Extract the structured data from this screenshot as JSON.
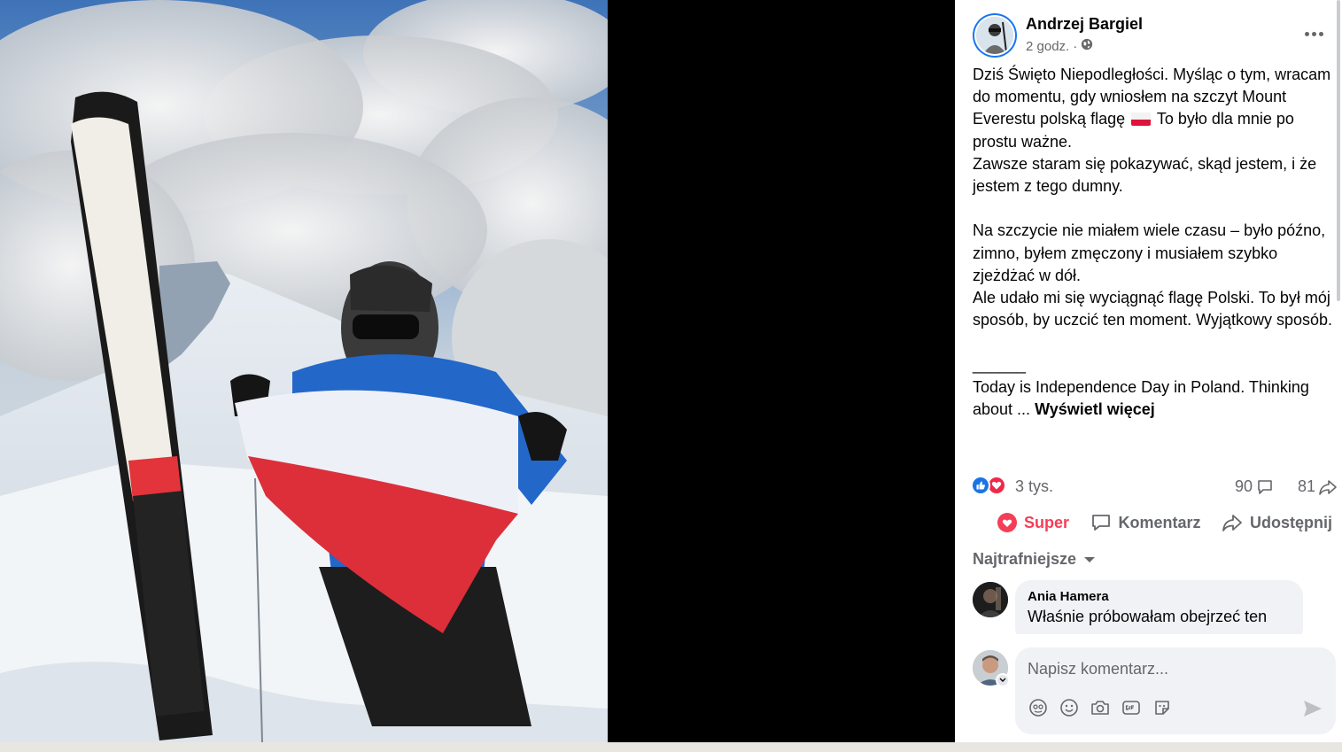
{
  "post": {
    "author": "Andrzej Bargiel",
    "time": "2 godz.",
    "separator": "·",
    "audience_icon": "globe-icon",
    "text_pl_1": "Dziś Święto Niepodległości. Myśląc o tym, wracam do momentu, gdy wniosłem na szczyt Mount Everestu polską flagę",
    "text_pl_1b": "To było dla mnie po prostu ważne.",
    "text_pl_2": "Zawsze staram się pokazywać, skąd jestem, i że jestem z tego dumny.",
    "text_pl_3": "Na szczycie nie miałem wiele czasu – było późno, zimno, byłem zmęczony i musiałem szybko zjeżdżać w dół.",
    "text_pl_4": "Ale udało mi się wyciągnąć flagę Polski. To był mój sposób, by uczcić ten moment. Wyjątkowy sposób.",
    "separator_line": "______",
    "text_en": "Today is Independence Day in Poland. Thinking about ...",
    "see_more": "Wyświetl więcej"
  },
  "stats": {
    "reactions": "3 tys.",
    "comments": "90",
    "shares": "81"
  },
  "actions": {
    "super": "Super",
    "comment": "Komentarz",
    "share": "Udostępnij"
  },
  "comments": {
    "sort": "Najtrafniejsze",
    "items": [
      {
        "author": "Ania Hamera",
        "text": "Właśnie próbowałam obejrzeć ten"
      }
    ]
  },
  "composer": {
    "placeholder": "Napisz komentarz..."
  },
  "colors": {
    "accent": "#1877f2",
    "love": "#f33e58",
    "secondary_text": "#65676b",
    "flag_red": "#dc143c"
  }
}
